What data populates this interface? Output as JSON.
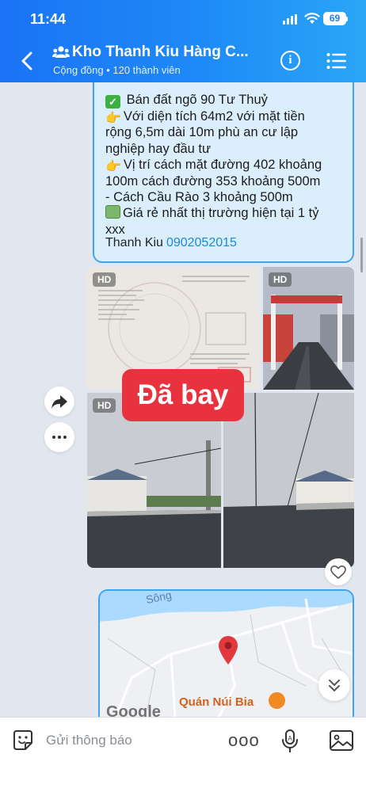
{
  "status": {
    "time": "11:44",
    "battery": "69"
  },
  "header": {
    "title": "Kho Thanh Kiu Hàng C...",
    "subtitle": "Cộng đồng • 120 thành viên"
  },
  "message": {
    "lines": [
      "Bán đất ngõ 90 Tư Thuỷ",
      "Với diện tích 64m2 với mặt tiền",
      "rộng 6,5m dài 10m phù an cư lập",
      "nghiệp hay đầu tư",
      "Vị trí cách mặt đường 402 khoảng",
      "100m cách đường 353 khoảng 500m",
      "- Cách Cầu Rào 3 khoảng 500m",
      "Giá rẻ nhất thị trường hiện tại 1 tỷ",
      "xxx"
    ],
    "sender": "Thanh Kiu",
    "phone": "0902052015"
  },
  "photos": {
    "hd_label": "HD",
    "sold_label": "Đã bay"
  },
  "map": {
    "river_label": "Sông",
    "place_label": "Quán Núi Bia",
    "google_label": "Google"
  },
  "composer": {
    "placeholder": "Gửi thông báo",
    "more_label": "ooo"
  },
  "icons": [
    "back-arrow-icon",
    "community-icon",
    "info-icon",
    "menu-icon",
    "share-icon",
    "more-icon",
    "heart-icon",
    "chevron-double-down-icon",
    "sticker-icon",
    "microphone-icon",
    "image-icon"
  ]
}
